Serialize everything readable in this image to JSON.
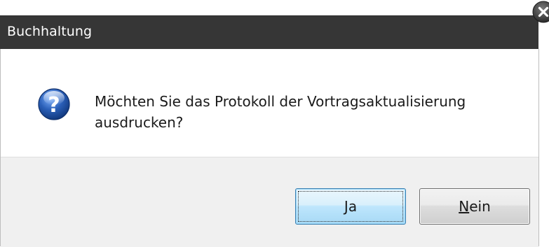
{
  "window": {
    "title": "Buchhaltung",
    "close_icon": "close-icon"
  },
  "message": {
    "icon": "question-icon",
    "text": "Möchten Sie das Protokoll der Vortragsaktualisierung ausdrucken?"
  },
  "buttons": {
    "yes": {
      "mnemonic": "J",
      "rest": "a"
    },
    "no": {
      "mnemonic": "N",
      "rest": "ein"
    }
  },
  "colors": {
    "titlebar": "#363636",
    "button_row": "#f0f0f0",
    "default_button_border": "#3c7fb1",
    "icon_blue": "#2a5fb8"
  }
}
